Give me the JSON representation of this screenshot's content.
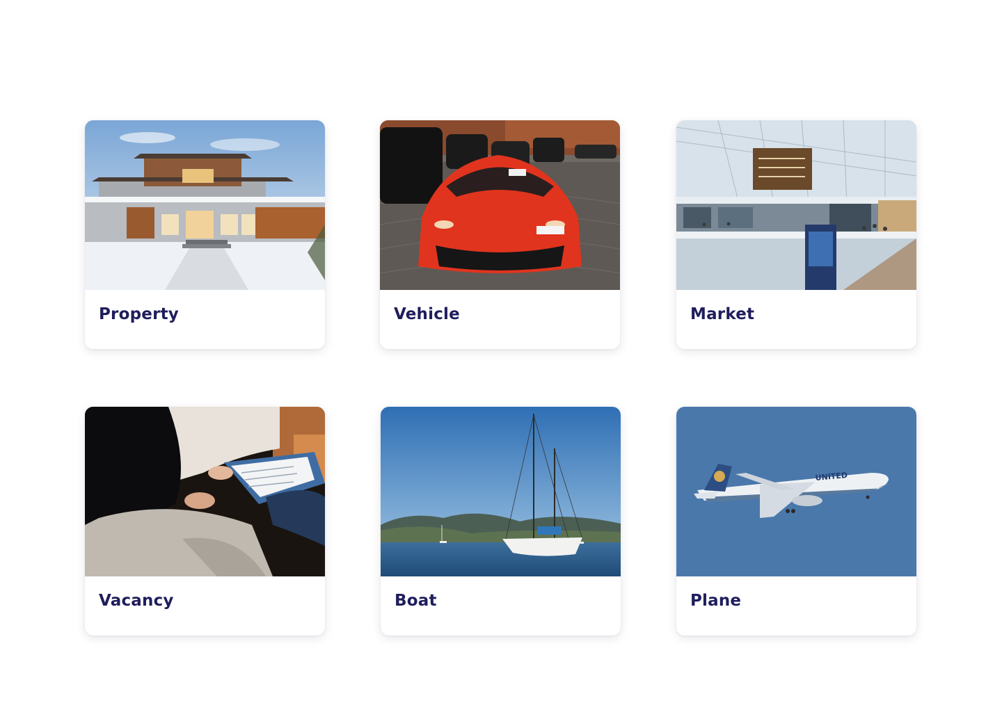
{
  "categories": [
    {
      "label": "Property",
      "image": "house-photo"
    },
    {
      "label": "Vehicle",
      "image": "sports-car-photo"
    },
    {
      "label": "Market",
      "image": "shopping-mall-photo"
    },
    {
      "label": "Vacancy",
      "image": "job-interview-photo"
    },
    {
      "label": "Boat",
      "image": "sailboat-photo"
    },
    {
      "label": "Plane",
      "image": "airplane-photo",
      "livery": "UNITED"
    }
  ],
  "colors": {
    "label_text": "#1f1d5c",
    "card_background": "#ffffff",
    "page_background": "#ffffff"
  }
}
